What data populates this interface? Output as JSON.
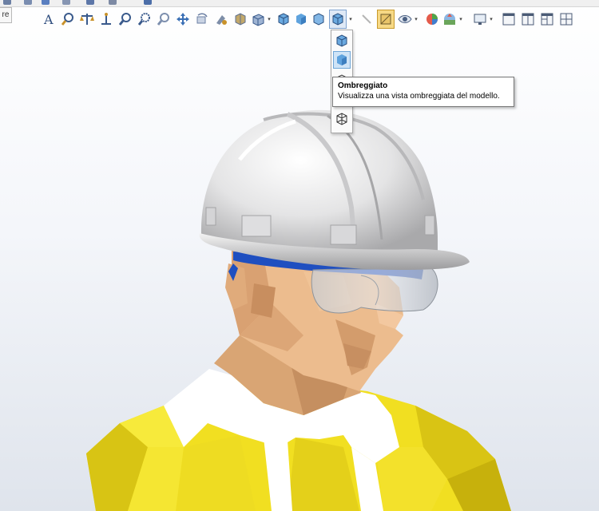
{
  "side_tab": {
    "label": "re"
  },
  "toolbar": {
    "buttons": [
      {
        "name": "annotation",
        "icon": "annotation-icon"
      },
      {
        "name": "zoom-to-fit",
        "icon": "zoom-to-fit-icon"
      },
      {
        "name": "measure",
        "icon": "scale-icon"
      },
      {
        "name": "section",
        "icon": "section-view-icon"
      },
      {
        "name": "zoom-area",
        "icon": "zoom-area-icon"
      },
      {
        "name": "zoom-in-out",
        "icon": "zoom-icon"
      },
      {
        "name": "zoom-selection",
        "icon": "zoom-selection-icon"
      },
      {
        "name": "pan",
        "icon": "pan-icon"
      },
      {
        "name": "rotate",
        "icon": "rotate-icon"
      },
      {
        "name": "previous-view",
        "icon": "previous-view-icon"
      },
      {
        "name": "section-view",
        "icon": "section-cube-icon"
      },
      {
        "name": "view-orientation",
        "icon": "view-orientation-icon"
      },
      {
        "name": "shaded-with-edges",
        "icon": "shaded-edges-cube-icon"
      },
      {
        "name": "shaded",
        "icon": "shaded-cube-icon"
      },
      {
        "name": "hidden-lines",
        "icon": "hidden-lines-cube-icon"
      },
      {
        "name": "display-style",
        "icon": "display-style-cube-icon"
      },
      {
        "name": "sketch",
        "icon": "sketch-icon"
      },
      {
        "name": "hide-show",
        "icon": "hide-show-icon"
      },
      {
        "name": "appearance",
        "icon": "appearance-icon"
      },
      {
        "name": "scene",
        "icon": "scene-icon"
      },
      {
        "name": "view-settings",
        "icon": "monitor-icon"
      },
      {
        "name": "single-view",
        "icon": "single-view-icon"
      },
      {
        "name": "two-view",
        "icon": "two-view-icon"
      },
      {
        "name": "two-view-horizontal",
        "icon": "two-view-horizontal-icon"
      },
      {
        "name": "four-view",
        "icon": "four-view-icon"
      }
    ]
  },
  "flyout": {
    "items": [
      {
        "name": "shaded-with-edges",
        "icon": "shaded-edges-cube-icon"
      },
      {
        "name": "shaded",
        "icon": "shaded-cube-icon"
      },
      {
        "name": "hidden-lines-removed",
        "icon": "hidden-lines-cube-icon"
      },
      {
        "name": "hidden-lines-visible",
        "icon": "hidden-lines-visible-icon"
      },
      {
        "name": "wireframe",
        "icon": "wireframe-cube-icon"
      }
    ]
  },
  "tooltip": {
    "title": "Ombreggiato",
    "description": "Visualizza una vista ombreggiata del modello."
  },
  "colors": {
    "helmet": "#e9e9ea",
    "skin": "#e8b88a",
    "shirt": "#f2e22a",
    "glasses_frame": "#1f4fc0",
    "tooltip_border": "#767676",
    "active_button": "#f7d985"
  }
}
